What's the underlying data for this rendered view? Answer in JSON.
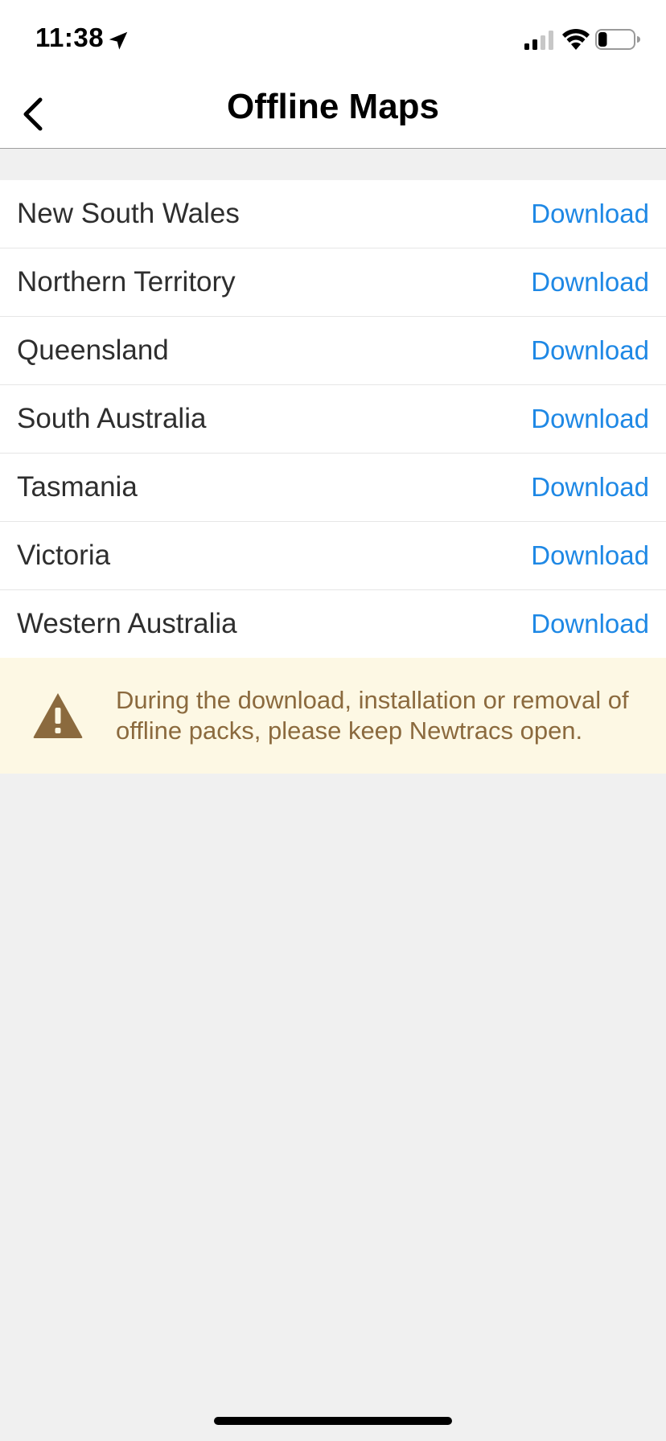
{
  "status_bar": {
    "time": "11:38",
    "battery_level": 0.25
  },
  "header": {
    "title": "Offline Maps",
    "back_icon": "chevron-left-icon"
  },
  "regions": [
    {
      "name": "New South Wales",
      "action": "Download"
    },
    {
      "name": "Northern Territory",
      "action": "Download"
    },
    {
      "name": "Queensland",
      "action": "Download"
    },
    {
      "name": "South Australia",
      "action": "Download"
    },
    {
      "name": "Tasmania",
      "action": "Download"
    },
    {
      "name": "Victoria",
      "action": "Download"
    },
    {
      "name": "Western Australia",
      "action": "Download"
    }
  ],
  "notice": {
    "icon": "warning-icon",
    "text": "During the download, installation or removal of offline packs, please keep Newtracs open."
  },
  "colors": {
    "accent": "#1e88e5",
    "notice_bg": "#fdf8e4",
    "notice_text": "#8b6a3e"
  }
}
